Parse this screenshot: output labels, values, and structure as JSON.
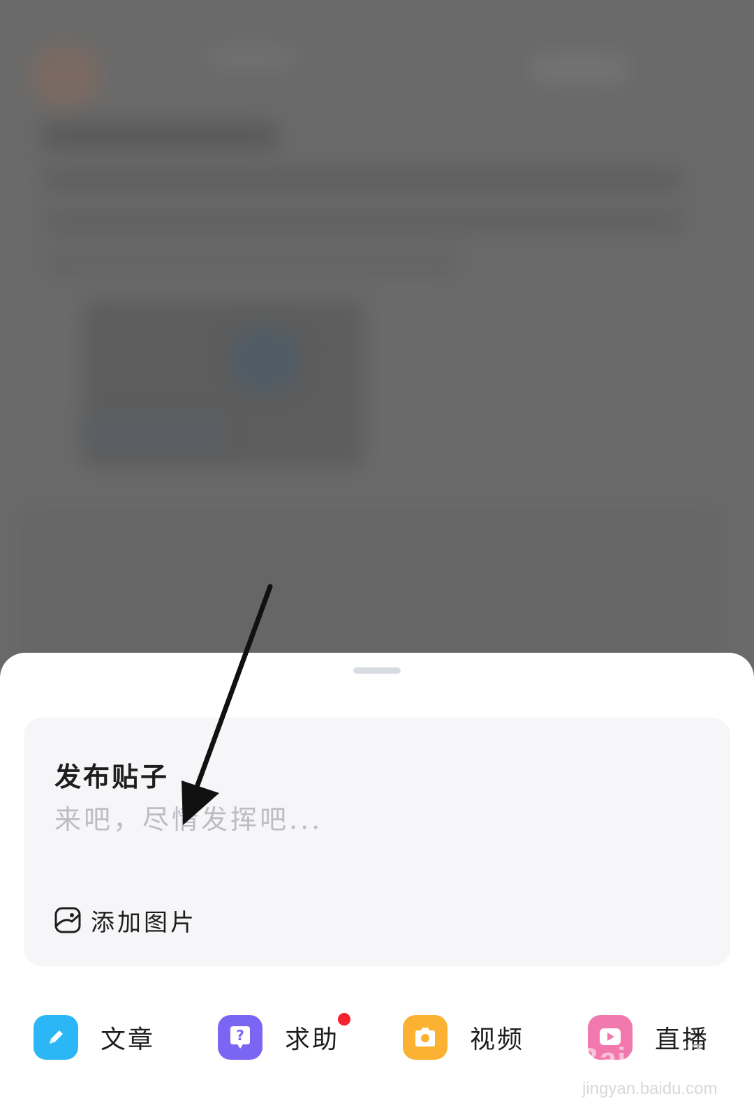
{
  "compose": {
    "title": "发布贴子",
    "placeholder": "来吧，尽情发挥吧...",
    "add_image_label": "添加图片",
    "add_image_icon": "image-icon"
  },
  "post_types": [
    {
      "label": "文章",
      "icon": "pencil-icon",
      "color": "#2bb6f5",
      "badge": false
    },
    {
      "label": "求助",
      "icon": "question-bubble-icon",
      "color": "#7a66f2",
      "badge": true
    },
    {
      "label": "视频",
      "icon": "camera-icon",
      "color": "#fbb233",
      "badge": false
    },
    {
      "label": "直播",
      "icon": "live-icon",
      "color": "#f279ad",
      "badge": false
    }
  ],
  "colors": {
    "sheet_background": "#ffffff",
    "compose_background": "#f6f6f8",
    "placeholder_text": "#bcbcc2",
    "badge_red": "#f5222d",
    "dimmed_backdrop": "#6b6b6b"
  },
  "watermark": {
    "brand": "Baidu 经验",
    "url": "jingyan.baidu.com"
  }
}
